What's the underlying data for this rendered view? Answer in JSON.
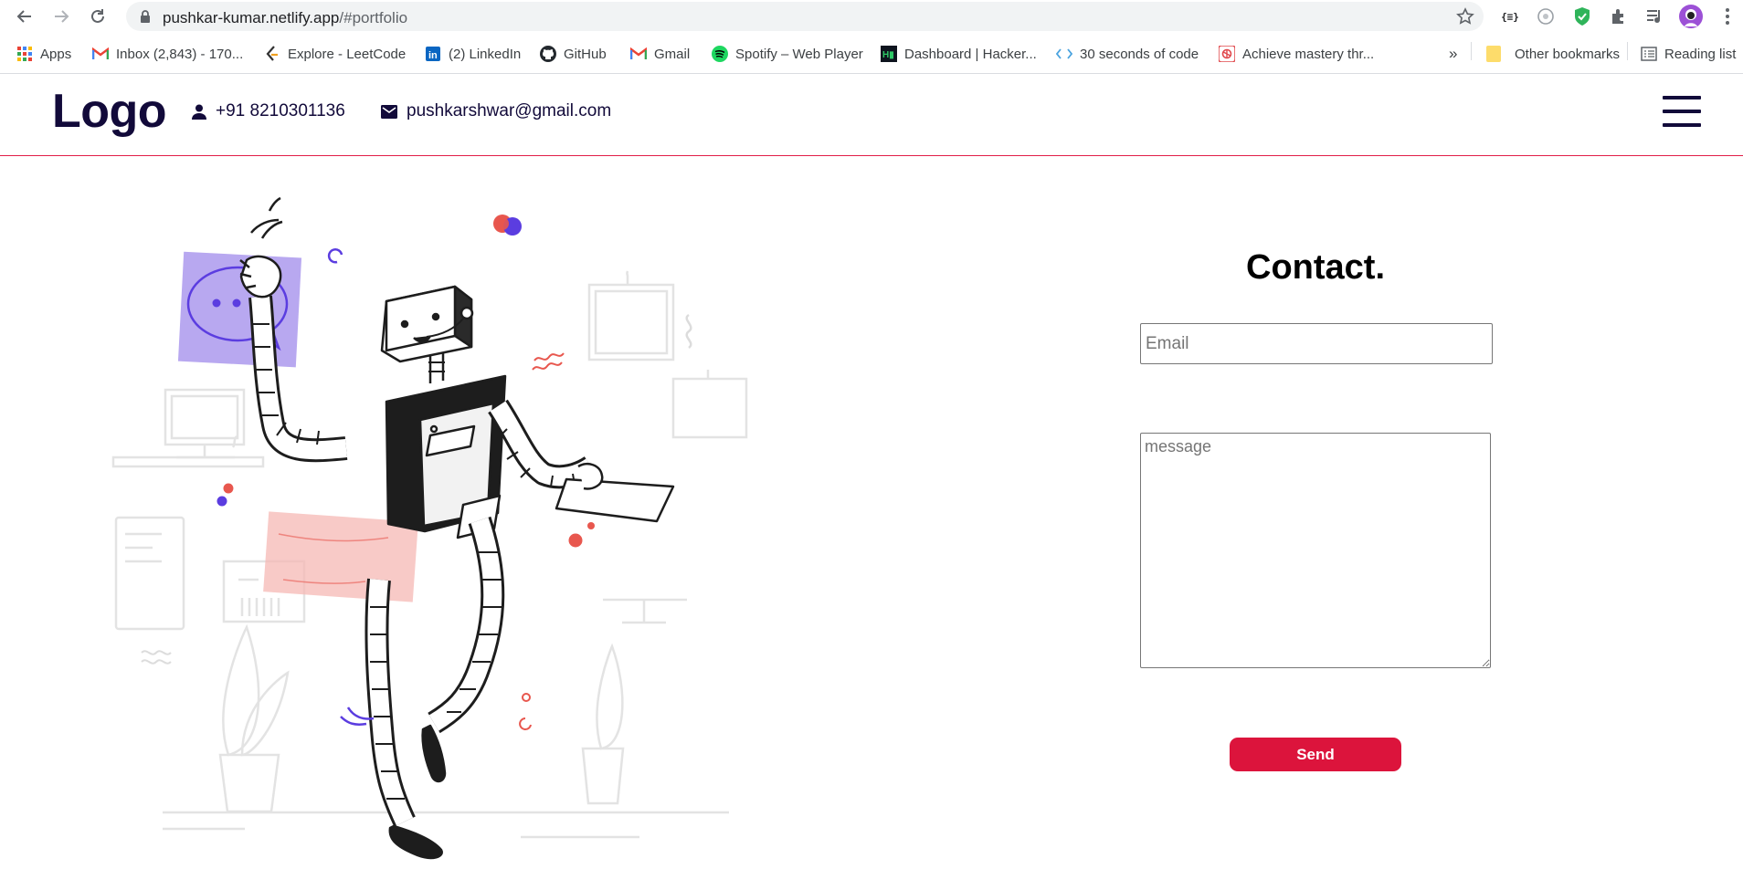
{
  "browser": {
    "url_host": "pushkar-kumar.netlify.app",
    "url_path": "/#portfolio",
    "bookmarks": [
      {
        "label": "Apps",
        "icon": "apps-grid-icon"
      },
      {
        "label": "Inbox (2,843) - 170...",
        "icon": "gmail-icon"
      },
      {
        "label": "Explore - LeetCode",
        "icon": "leetcode-icon"
      },
      {
        "label": "(2) LinkedIn",
        "icon": "linkedin-icon"
      },
      {
        "label": "GitHub",
        "icon": "github-icon"
      },
      {
        "label": "Gmail",
        "icon": "gmail-icon"
      },
      {
        "label": "Spotify – Web Player",
        "icon": "spotify-icon"
      },
      {
        "label": "Dashboard | Hacker...",
        "icon": "hackerrank-icon"
      },
      {
        "label": "30 seconds of code",
        "icon": "code-icon"
      },
      {
        "label": "Achieve mastery thr...",
        "icon": "openai-icon"
      }
    ],
    "overflow_label": "»",
    "other_bookmarks": "Other bookmarks",
    "reading_list": "Reading list"
  },
  "header": {
    "logo": "Logo",
    "phone": "+91 8210301136",
    "email": "pushkarshwar@gmail.com"
  },
  "contact": {
    "title": "Contact.",
    "email_placeholder": "Email",
    "message_placeholder": "message",
    "send_label": "Send"
  },
  "colors": {
    "accent": "#dc143c",
    "navy": "#120a3a",
    "purple": "#5b3de0",
    "coral": "#e8574e"
  }
}
